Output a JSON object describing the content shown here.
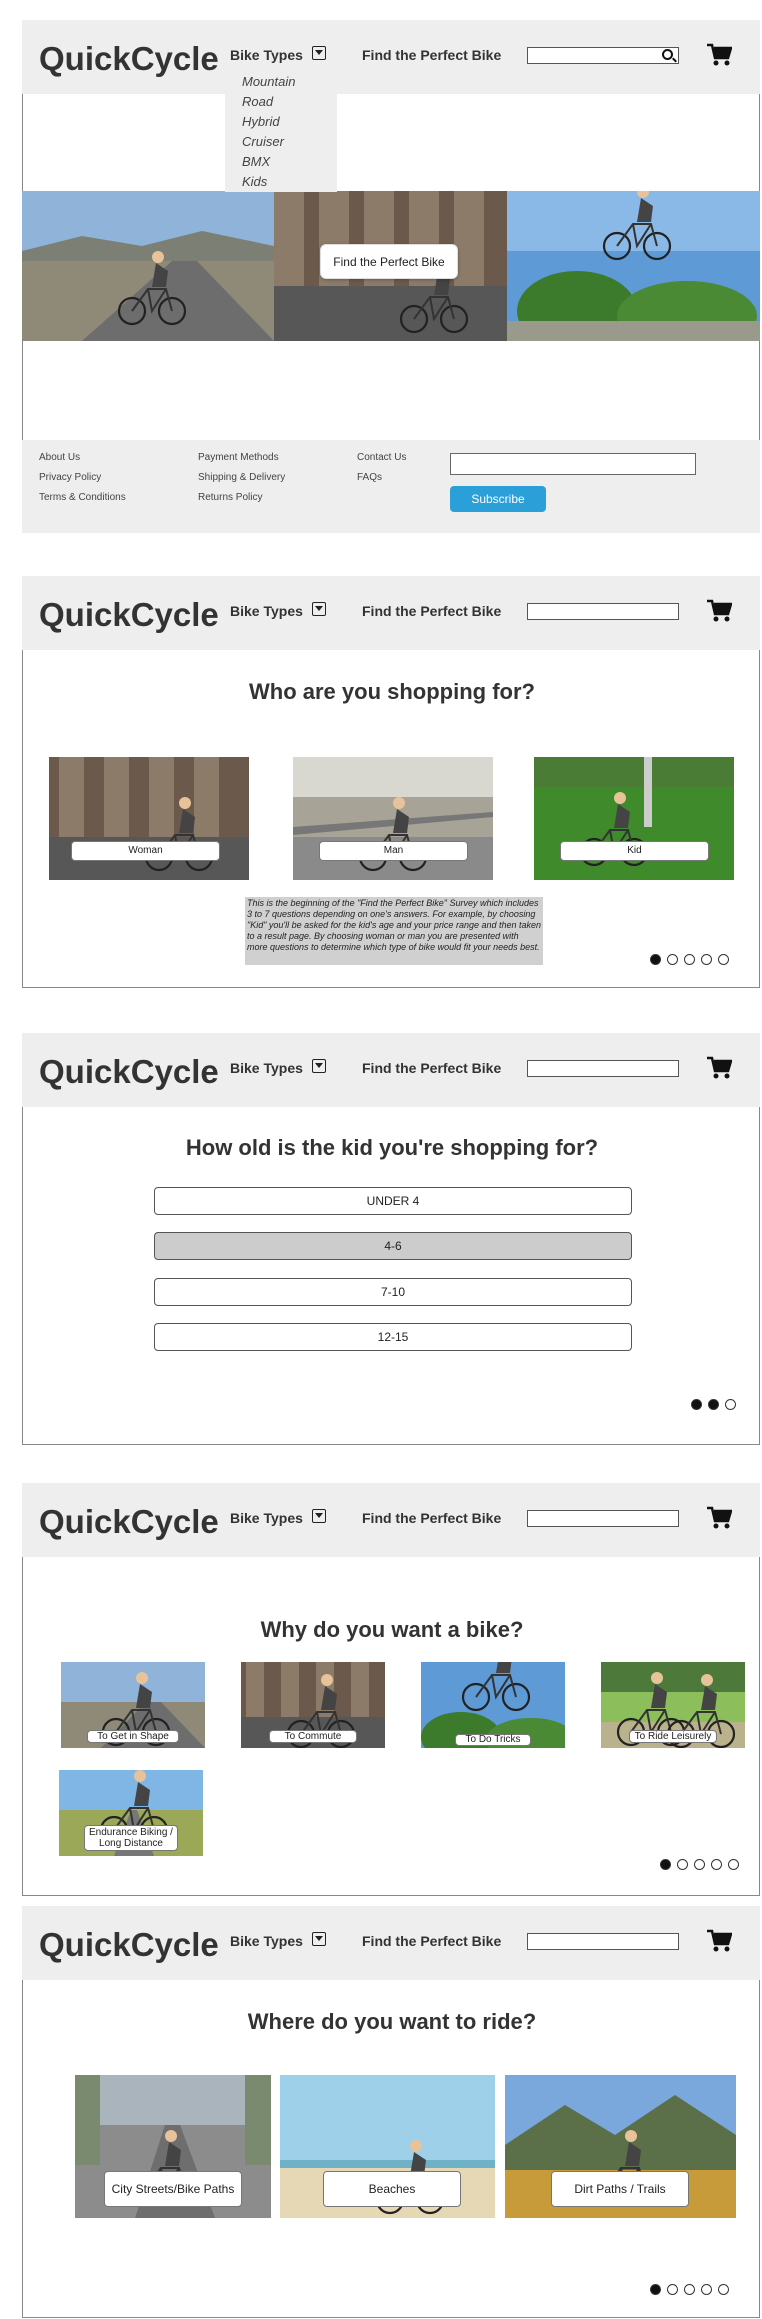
{
  "brand": "QuickCycle",
  "nav": {
    "bike_types": "Bike Types",
    "survey": "Find the Perfect Bike",
    "search_placeholder": ""
  },
  "colors": {
    "header_bg": "#eeeeee",
    "subscribe_btn": "#2a9fd8",
    "selected_option": "#cccccc"
  },
  "home": {
    "dropdown": [
      "Mountain",
      "Road",
      "Hybrid",
      "Cruiser",
      "BMX",
      "Kids"
    ],
    "hero_cta": "Find the Perfect Bike",
    "footer": {
      "col1": [
        "About Us",
        "Privacy Policy",
        "Terms & Conditions"
      ],
      "col2": [
        "Payment Methods",
        "Shipping & Delivery",
        "Returns Policy"
      ],
      "col3": [
        "Contact Us",
        "FAQs"
      ],
      "subscribe_label": "Subscribe"
    }
  },
  "q1": {
    "title": "Who are you shopping for?",
    "options": [
      "Woman",
      "Man",
      "Kid"
    ],
    "note": "This is the beginning of the \"Find the Perfect Bike\" Survey which includes 3 to 7 questions depending on one's answers. For example, by choosing \"Kid\" you'll be asked for the kid's age and your price range and then taken to a result page. By choosing woman or man you are presented with more questions to determine which type of bike would fit your needs best.",
    "progress": {
      "current": 1,
      "total": 5
    }
  },
  "q2": {
    "title": "How old is the kid you're shopping for?",
    "options": [
      "UNDER 4",
      "4-6",
      "7-10",
      "12-15"
    ],
    "selected": "4-6",
    "progress": {
      "current": 2,
      "total": 3
    }
  },
  "q3": {
    "title": "Why do you want a bike?",
    "options": [
      "To Get in Shape",
      "To Commute",
      "To Do Tricks",
      "To Ride Leisurely"
    ],
    "option5_line1": "Endurance Biking /",
    "option5_line2": "Long Distance",
    "progress": {
      "current": 1,
      "total": 5
    }
  },
  "q4": {
    "title": "Where do you want to ride?",
    "options": [
      "City Streets/Bike Paths",
      "Beaches",
      "Dirt Paths / Trails"
    ],
    "progress": {
      "current": 1,
      "total": 5
    }
  }
}
